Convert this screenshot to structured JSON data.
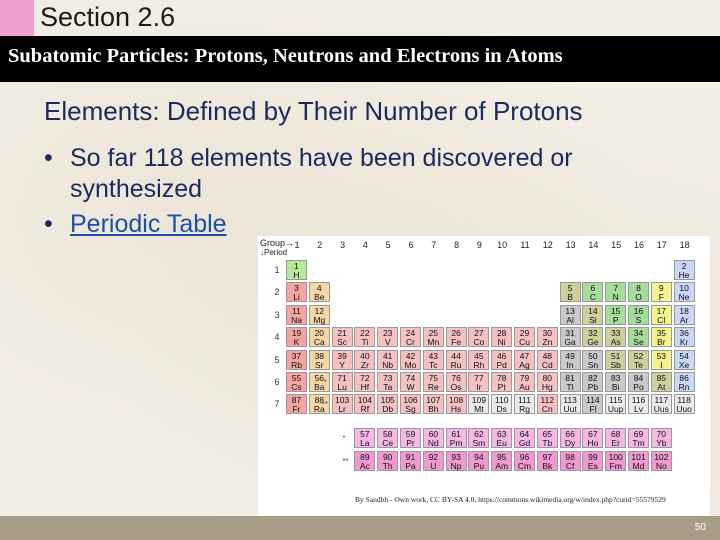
{
  "section": "Section 2.6",
  "title": "Subatomic Particles: Protons, Neutrons and Electrons in Atoms",
  "heading": "Elements:  Defined by Their Number of Protons",
  "bullets": [
    {
      "text": "So far 118 elements have been discovered or synthesized",
      "is_link": false
    },
    {
      "text": "Periodic Table",
      "is_link": true
    }
  ],
  "periodic_table": {
    "group_label": "Group→",
    "period_label": "↓Period",
    "groups": [
      "1",
      "2",
      "3",
      "4",
      "5",
      "6",
      "7",
      "8",
      "9",
      "10",
      "11",
      "12",
      "13",
      "14",
      "15",
      "16",
      "17",
      "18"
    ],
    "periods": [
      "1",
      "2",
      "3",
      "4",
      "5",
      "6",
      "7"
    ],
    "colors": {
      "alkali": "#f6a3a3",
      "alkaline": "#f5d6a6",
      "transition": "#f5c1c1",
      "post_transition": "#c9c9c9",
      "metalloid": "#cfcf9b",
      "nonmetal": "#a7dd9a",
      "halogen": "#f3f38f",
      "noble": "#c8d8f5",
      "lanthanide": "#f6b8e3",
      "actinide": "#f09ad1",
      "hydrogen": "#b8e89a",
      "unknown": "#eaeaea"
    },
    "elements": [
      {
        "n": "1",
        "s": "H",
        "g": 1,
        "p": 1,
        "c": "hydrogen"
      },
      {
        "n": "2",
        "s": "He",
        "g": 18,
        "p": 1,
        "c": "noble"
      },
      {
        "n": "3",
        "s": "Li",
        "g": 1,
        "p": 2,
        "c": "alkali"
      },
      {
        "n": "4",
        "s": "Be",
        "g": 2,
        "p": 2,
        "c": "alkaline"
      },
      {
        "n": "5",
        "s": "B",
        "g": 13,
        "p": 2,
        "c": "metalloid"
      },
      {
        "n": "6",
        "s": "C",
        "g": 14,
        "p": 2,
        "c": "nonmetal"
      },
      {
        "n": "7",
        "s": "N",
        "g": 15,
        "p": 2,
        "c": "nonmetal"
      },
      {
        "n": "8",
        "s": "O",
        "g": 16,
        "p": 2,
        "c": "nonmetal"
      },
      {
        "n": "9",
        "s": "F",
        "g": 17,
        "p": 2,
        "c": "halogen"
      },
      {
        "n": "10",
        "s": "Ne",
        "g": 18,
        "p": 2,
        "c": "noble"
      },
      {
        "n": "11",
        "s": "Na",
        "g": 1,
        "p": 3,
        "c": "alkali"
      },
      {
        "n": "12",
        "s": "Mg",
        "g": 2,
        "p": 3,
        "c": "alkaline"
      },
      {
        "n": "13",
        "s": "Al",
        "g": 13,
        "p": 3,
        "c": "post_transition"
      },
      {
        "n": "14",
        "s": "Si",
        "g": 14,
        "p": 3,
        "c": "metalloid"
      },
      {
        "n": "15",
        "s": "P",
        "g": 15,
        "p": 3,
        "c": "nonmetal"
      },
      {
        "n": "16",
        "s": "S",
        "g": 16,
        "p": 3,
        "c": "nonmetal"
      },
      {
        "n": "17",
        "s": "Cl",
        "g": 17,
        "p": 3,
        "c": "halogen"
      },
      {
        "n": "18",
        "s": "Ar",
        "g": 18,
        "p": 3,
        "c": "noble"
      },
      {
        "n": "19",
        "s": "K",
        "g": 1,
        "p": 4,
        "c": "alkali"
      },
      {
        "n": "20",
        "s": "Ca",
        "g": 2,
        "p": 4,
        "c": "alkaline"
      },
      {
        "n": "21",
        "s": "Sc",
        "g": 3,
        "p": 4,
        "c": "transition"
      },
      {
        "n": "22",
        "s": "Ti",
        "g": 4,
        "p": 4,
        "c": "transition"
      },
      {
        "n": "23",
        "s": "V",
        "g": 5,
        "p": 4,
        "c": "transition"
      },
      {
        "n": "24",
        "s": "Cr",
        "g": 6,
        "p": 4,
        "c": "transition"
      },
      {
        "n": "25",
        "s": "Mn",
        "g": 7,
        "p": 4,
        "c": "transition"
      },
      {
        "n": "26",
        "s": "Fe",
        "g": 8,
        "p": 4,
        "c": "transition"
      },
      {
        "n": "27",
        "s": "Co",
        "g": 9,
        "p": 4,
        "c": "transition"
      },
      {
        "n": "28",
        "s": "Ni",
        "g": 10,
        "p": 4,
        "c": "transition"
      },
      {
        "n": "29",
        "s": "Cu",
        "g": 11,
        "p": 4,
        "c": "transition"
      },
      {
        "n": "30",
        "s": "Zn",
        "g": 12,
        "p": 4,
        "c": "transition"
      },
      {
        "n": "31",
        "s": "Ga",
        "g": 13,
        "p": 4,
        "c": "post_transition"
      },
      {
        "n": "32",
        "s": "Ge",
        "g": 14,
        "p": 4,
        "c": "metalloid"
      },
      {
        "n": "33",
        "s": "As",
        "g": 15,
        "p": 4,
        "c": "metalloid"
      },
      {
        "n": "34",
        "s": "Se",
        "g": 16,
        "p": 4,
        "c": "nonmetal"
      },
      {
        "n": "35",
        "s": "Br",
        "g": 17,
        "p": 4,
        "c": "halogen"
      },
      {
        "n": "36",
        "s": "Kr",
        "g": 18,
        "p": 4,
        "c": "noble"
      },
      {
        "n": "37",
        "s": "Rb",
        "g": 1,
        "p": 5,
        "c": "alkali"
      },
      {
        "n": "38",
        "s": "Sr",
        "g": 2,
        "p": 5,
        "c": "alkaline"
      },
      {
        "n": "39",
        "s": "Y",
        "g": 3,
        "p": 5,
        "c": "transition"
      },
      {
        "n": "40",
        "s": "Zr",
        "g": 4,
        "p": 5,
        "c": "transition"
      },
      {
        "n": "41",
        "s": "Nb",
        "g": 5,
        "p": 5,
        "c": "transition"
      },
      {
        "n": "42",
        "s": "Mo",
        "g": 6,
        "p": 5,
        "c": "transition"
      },
      {
        "n": "43",
        "s": "Tc",
        "g": 7,
        "p": 5,
        "c": "transition"
      },
      {
        "n": "44",
        "s": "Ru",
        "g": 8,
        "p": 5,
        "c": "transition"
      },
      {
        "n": "45",
        "s": "Rh",
        "g": 9,
        "p": 5,
        "c": "transition"
      },
      {
        "n": "46",
        "s": "Pd",
        "g": 10,
        "p": 5,
        "c": "transition"
      },
      {
        "n": "47",
        "s": "Ag",
        "g": 11,
        "p": 5,
        "c": "transition"
      },
      {
        "n": "48",
        "s": "Cd",
        "g": 12,
        "p": 5,
        "c": "transition"
      },
      {
        "n": "49",
        "s": "In",
        "g": 13,
        "p": 5,
        "c": "post_transition"
      },
      {
        "n": "50",
        "s": "Sn",
        "g": 14,
        "p": 5,
        "c": "post_transition"
      },
      {
        "n": "51",
        "s": "Sb",
        "g": 15,
        "p": 5,
        "c": "metalloid"
      },
      {
        "n": "52",
        "s": "Te",
        "g": 16,
        "p": 5,
        "c": "metalloid"
      },
      {
        "n": "53",
        "s": "I",
        "g": 17,
        "p": 5,
        "c": "halogen"
      },
      {
        "n": "54",
        "s": "Xe",
        "g": 18,
        "p": 5,
        "c": "noble"
      },
      {
        "n": "55",
        "s": "Cs",
        "g": 1,
        "p": 6,
        "c": "alkali"
      },
      {
        "n": "56",
        "s": "Ba",
        "g": 2,
        "p": 6,
        "c": "alkaline"
      },
      {
        "n": "71",
        "s": "Lu",
        "g": 3,
        "p": 6,
        "c": "transition"
      },
      {
        "n": "72",
        "s": "Hf",
        "g": 4,
        "p": 6,
        "c": "transition"
      },
      {
        "n": "73",
        "s": "Ta",
        "g": 5,
        "p": 6,
        "c": "transition"
      },
      {
        "n": "74",
        "s": "W",
        "g": 6,
        "p": 6,
        "c": "transition"
      },
      {
        "n": "75",
        "s": "Re",
        "g": 7,
        "p": 6,
        "c": "transition"
      },
      {
        "n": "76",
        "s": "Os",
        "g": 8,
        "p": 6,
        "c": "transition"
      },
      {
        "n": "77",
        "s": "Ir",
        "g": 9,
        "p": 6,
        "c": "transition"
      },
      {
        "n": "78",
        "s": "Pt",
        "g": 10,
        "p": 6,
        "c": "transition"
      },
      {
        "n": "79",
        "s": "Au",
        "g": 11,
        "p": 6,
        "c": "transition"
      },
      {
        "n": "80",
        "s": "Hg",
        "g": 12,
        "p": 6,
        "c": "transition"
      },
      {
        "n": "81",
        "s": "Tl",
        "g": 13,
        "p": 6,
        "c": "post_transition"
      },
      {
        "n": "82",
        "s": "Pb",
        "g": 14,
        "p": 6,
        "c": "post_transition"
      },
      {
        "n": "83",
        "s": "Bi",
        "g": 15,
        "p": 6,
        "c": "post_transition"
      },
      {
        "n": "84",
        "s": "Po",
        "g": 16,
        "p": 6,
        "c": "post_transition"
      },
      {
        "n": "85",
        "s": "At",
        "g": 17,
        "p": 6,
        "c": "metalloid"
      },
      {
        "n": "86",
        "s": "Rn",
        "g": 18,
        "p": 6,
        "c": "noble"
      },
      {
        "n": "87",
        "s": "Fr",
        "g": 1,
        "p": 7,
        "c": "alkali"
      },
      {
        "n": "88",
        "s": "Ra",
        "g": 2,
        "p": 7,
        "c": "alkaline"
      },
      {
        "n": "103",
        "s": "Lr",
        "g": 3,
        "p": 7,
        "c": "transition"
      },
      {
        "n": "104",
        "s": "Rf",
        "g": 4,
        "p": 7,
        "c": "transition"
      },
      {
        "n": "105",
        "s": "Db",
        "g": 5,
        "p": 7,
        "c": "transition"
      },
      {
        "n": "106",
        "s": "Sg",
        "g": 6,
        "p": 7,
        "c": "transition"
      },
      {
        "n": "107",
        "s": "Bh",
        "g": 7,
        "p": 7,
        "c": "transition"
      },
      {
        "n": "108",
        "s": "Hs",
        "g": 8,
        "p": 7,
        "c": "transition"
      },
      {
        "n": "109",
        "s": "Mt",
        "g": 9,
        "p": 7,
        "c": "unknown"
      },
      {
        "n": "110",
        "s": "Ds",
        "g": 10,
        "p": 7,
        "c": "unknown"
      },
      {
        "n": "111",
        "s": "Rg",
        "g": 11,
        "p": 7,
        "c": "unknown"
      },
      {
        "n": "112",
        "s": "Cn",
        "g": 12,
        "p": 7,
        "c": "transition"
      },
      {
        "n": "113",
        "s": "Uut",
        "g": 13,
        "p": 7,
        "c": "unknown"
      },
      {
        "n": "114",
        "s": "Fl",
        "g": 14,
        "p": 7,
        "c": "post_transition"
      },
      {
        "n": "115",
        "s": "Uup",
        "g": 15,
        "p": 7,
        "c": "unknown"
      },
      {
        "n": "116",
        "s": "Lv",
        "g": 16,
        "p": 7,
        "c": "unknown"
      },
      {
        "n": "117",
        "s": "Uus",
        "g": 17,
        "p": 7,
        "c": "unknown"
      },
      {
        "n": "118",
        "s": "Uuo",
        "g": 18,
        "p": 7,
        "c": "unknown"
      }
    ],
    "f_block": [
      {
        "row": 1,
        "items": [
          [
            "57",
            "La"
          ],
          [
            "58",
            "Ce"
          ],
          [
            "59",
            "Pr"
          ],
          [
            "60",
            "Nd"
          ],
          [
            "61",
            "Pm"
          ],
          [
            "62",
            "Sm"
          ],
          [
            "63",
            "Eu"
          ],
          [
            "64",
            "Gd"
          ],
          [
            "65",
            "Tb"
          ],
          [
            "66",
            "Dy"
          ],
          [
            "67",
            "Ho"
          ],
          [
            "68",
            "Er"
          ],
          [
            "69",
            "Tm"
          ],
          [
            "70",
            "Yb"
          ]
        ],
        "c": "lanthanide"
      },
      {
        "row": 2,
        "items": [
          [
            "89",
            "Ac"
          ],
          [
            "90",
            "Th"
          ],
          [
            "91",
            "Pa"
          ],
          [
            "92",
            "U"
          ],
          [
            "93",
            "Np"
          ],
          [
            "94",
            "Pu"
          ],
          [
            "95",
            "Am"
          ],
          [
            "96",
            "Cm"
          ],
          [
            "97",
            "Bk"
          ],
          [
            "98",
            "Cf"
          ],
          [
            "99",
            "Es"
          ],
          [
            "100",
            "Fm"
          ],
          [
            "101",
            "Md"
          ],
          [
            "102",
            "No"
          ]
        ],
        "c": "actinide"
      }
    ],
    "markers": [
      "*",
      "**"
    ]
  },
  "credit": "By Sandbh - Own work, CC BY-SA 4.0, https://commons.wikimedia.org/w/index.php?curid=55579529",
  "page_number": "50"
}
